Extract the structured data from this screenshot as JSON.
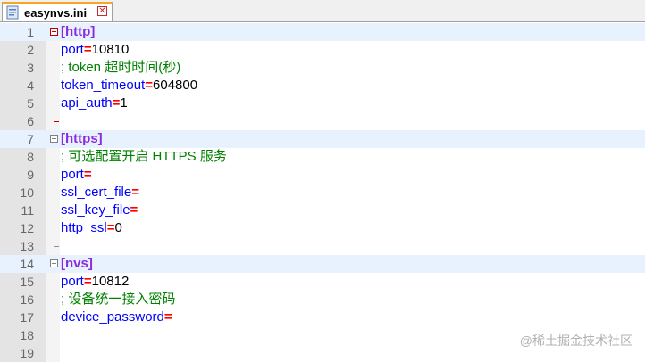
{
  "tab": {
    "title": "easynvs.ini",
    "close_glyph": "✕",
    "icon": "ini-file-icon"
  },
  "lines": [
    {
      "n": "1",
      "type": "section",
      "name": "http"
    },
    {
      "n": "2",
      "type": "kv",
      "key": "port",
      "eq": "=",
      "val": "10810"
    },
    {
      "n": "3",
      "type": "comment",
      "text": "; token 超时时间(秒)"
    },
    {
      "n": "4",
      "type": "kv",
      "key": "token_timeout",
      "eq": "=",
      "val": "604800"
    },
    {
      "n": "5",
      "type": "kv",
      "key": "api_auth",
      "eq": "=",
      "val": "1"
    },
    {
      "n": "6",
      "type": "blank"
    },
    {
      "n": "7",
      "type": "section",
      "name": "https"
    },
    {
      "n": "8",
      "type": "comment",
      "text": "; 可选配置开启 HTTPS 服务"
    },
    {
      "n": "9",
      "type": "kv",
      "key": "port",
      "eq": "=",
      "val": ""
    },
    {
      "n": "10",
      "type": "kv",
      "key": "ssl_cert_file",
      "eq": "=",
      "val": ""
    },
    {
      "n": "11",
      "type": "kv",
      "key": "ssl_key_file",
      "eq": "=",
      "val": ""
    },
    {
      "n": "12",
      "type": "kv",
      "key": "http_ssl",
      "eq": "=",
      "val": "0"
    },
    {
      "n": "13",
      "type": "blank"
    },
    {
      "n": "14",
      "type": "section",
      "name": "nvs"
    },
    {
      "n": "15",
      "type": "kv",
      "key": "port",
      "eq": "=",
      "val": "10812"
    },
    {
      "n": "16",
      "type": "comment",
      "text": "; 设备统一接入密码"
    },
    {
      "n": "17",
      "type": "kv",
      "key": "device_password",
      "eq": "=",
      "val": ""
    },
    {
      "n": "18",
      "type": "blank"
    },
    {
      "n": "19",
      "type": "blank"
    }
  ],
  "watermark": "@稀土掘金技术社区",
  "colors": {
    "section": "#8a2be2",
    "key": "#0000ff",
    "equals": "#ff0000",
    "comment": "#008000",
    "active_fold": "#c00000",
    "tab_accent": "#f6a623"
  }
}
